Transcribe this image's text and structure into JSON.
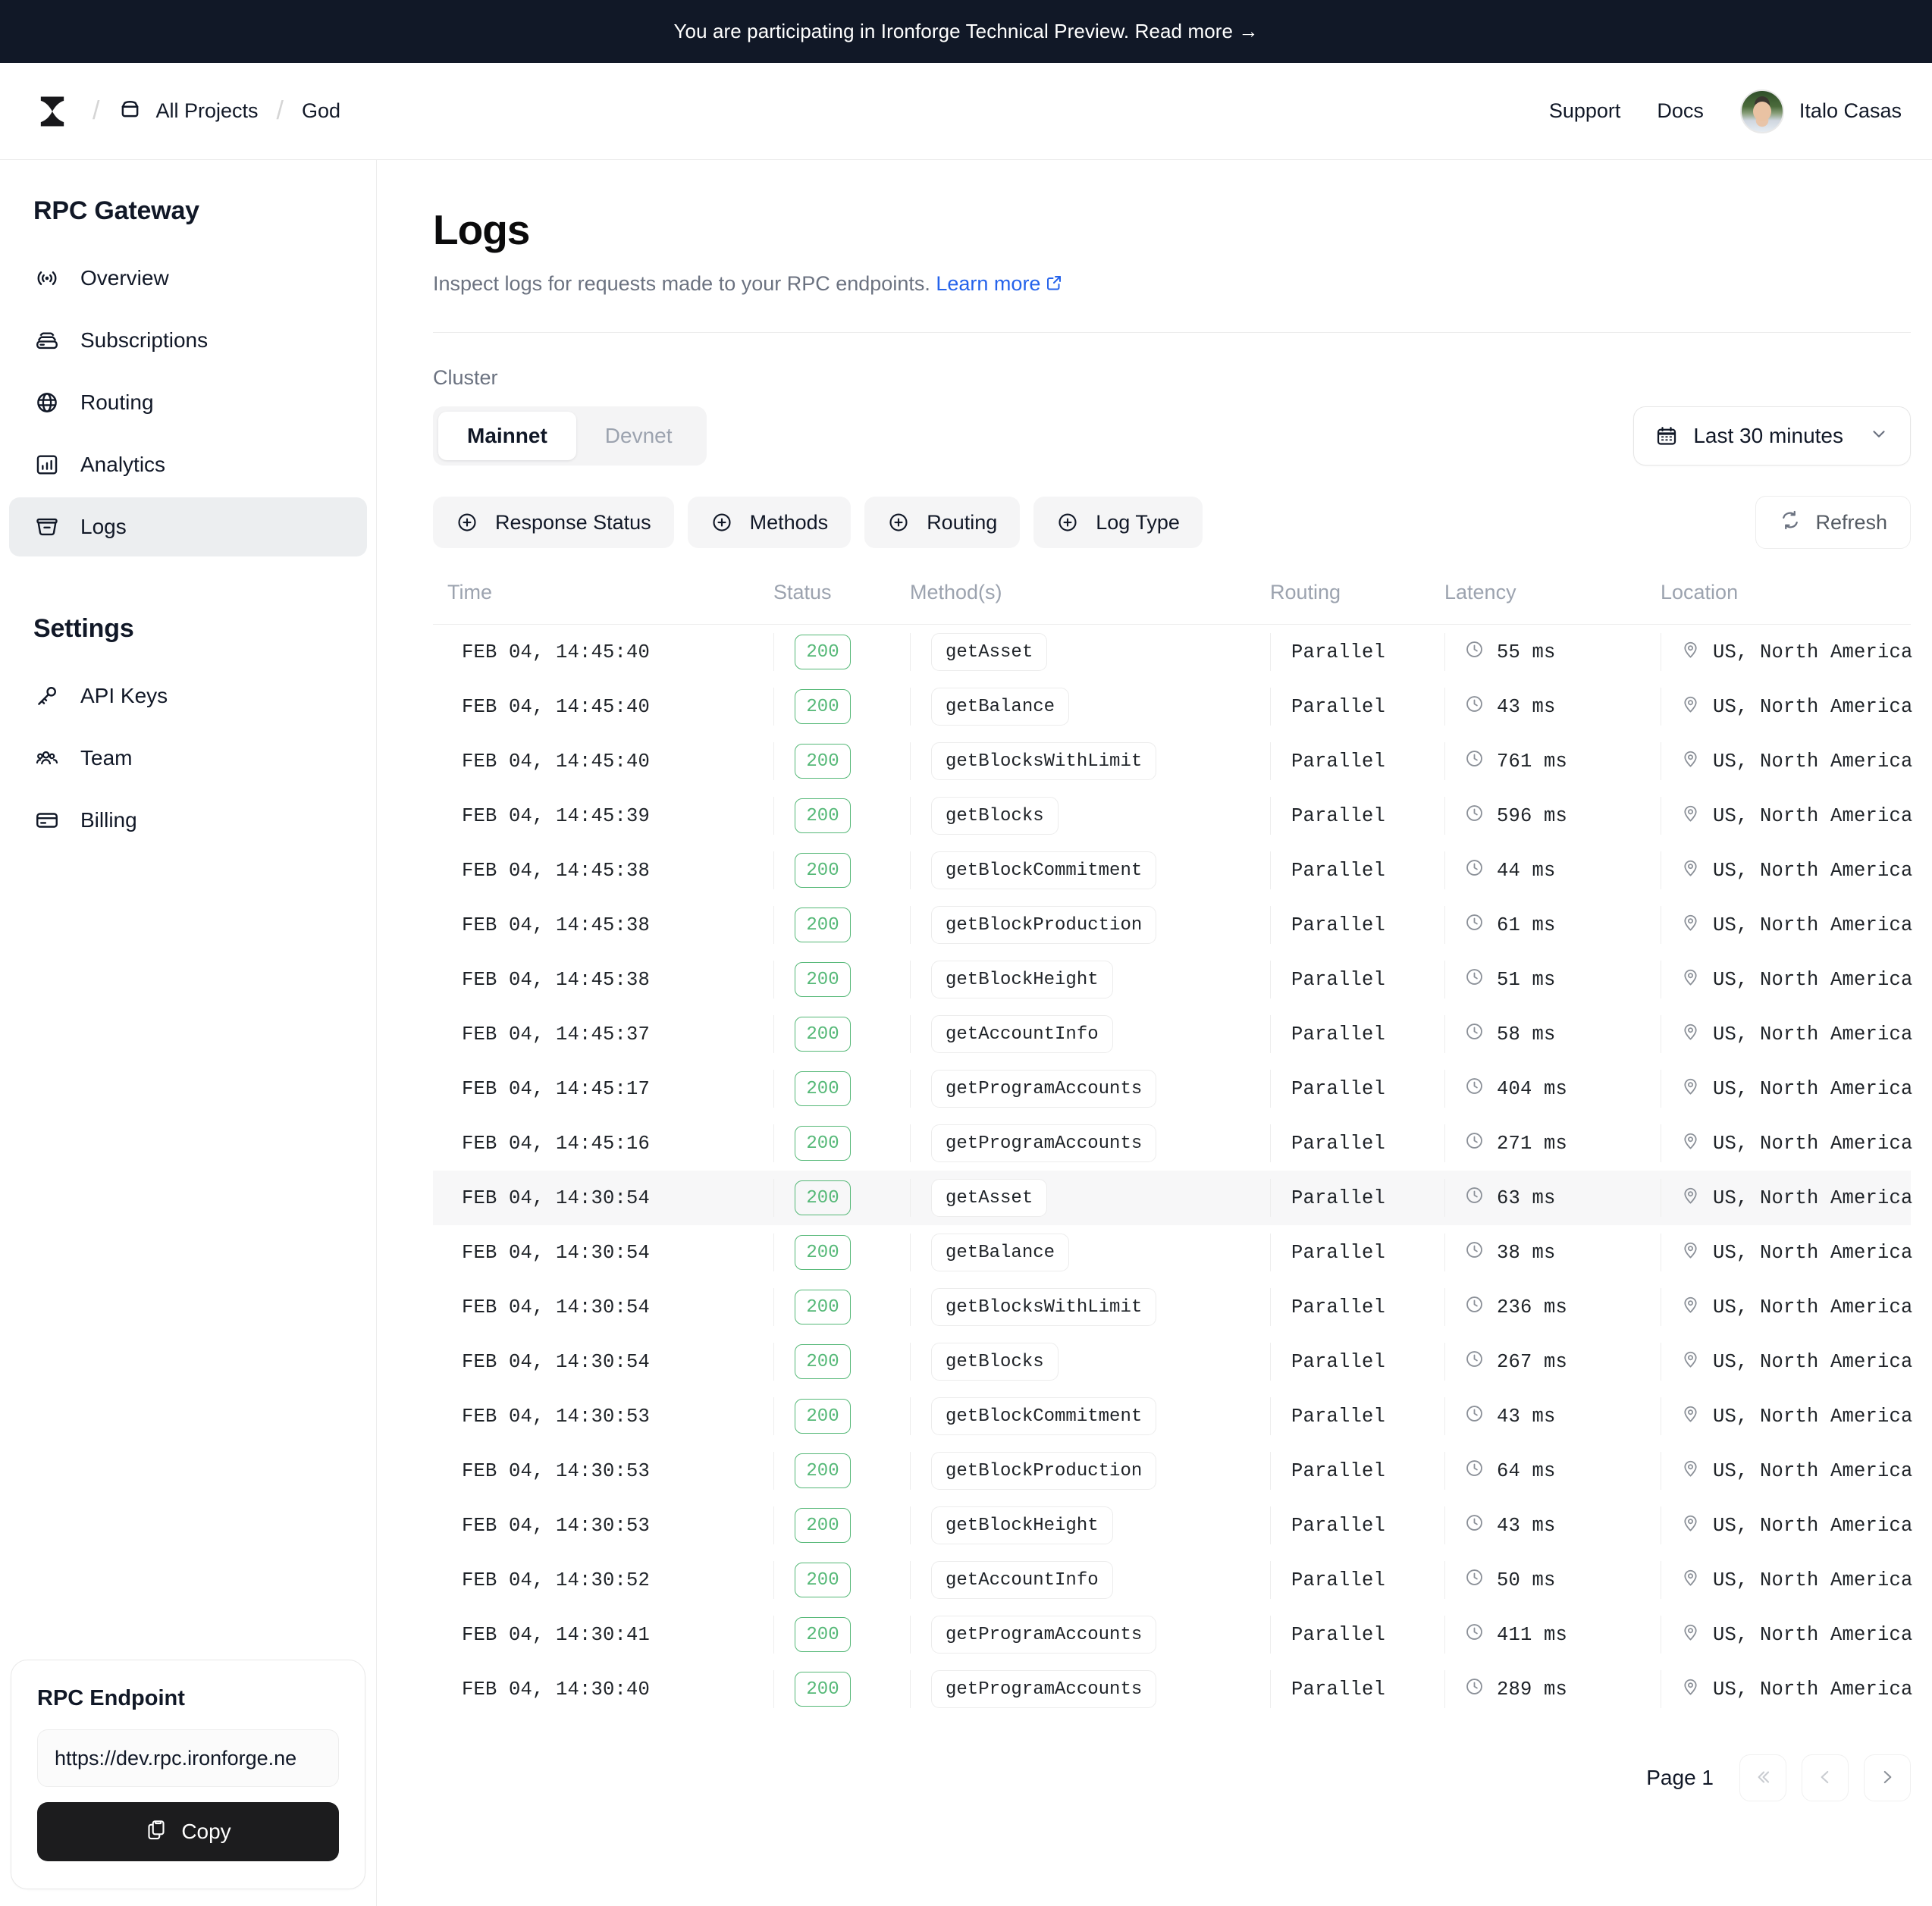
{
  "announcement": {
    "text": "You are participating in Ironforge Technical Preview. Read more →"
  },
  "topnav": {
    "logo_icon": "anvil-logo",
    "breadcrumb": [
      {
        "label": "All Projects",
        "icon": "box-icon"
      },
      {
        "label": "God",
        "icon": ""
      }
    ],
    "links": [
      "Support",
      "Docs"
    ],
    "user": {
      "name": "Italo Casas",
      "avatar_icon": "user-avatar"
    }
  },
  "sidebar": {
    "section1_title": "RPC Gateway",
    "section1_items": [
      {
        "label": "Overview",
        "icon": "broadcast-icon",
        "active": false
      },
      {
        "label": "Subscriptions",
        "icon": "server-stack-icon",
        "active": false
      },
      {
        "label": "Routing",
        "icon": "globe-icon",
        "active": false
      },
      {
        "label": "Analytics",
        "icon": "bar-chart-icon",
        "active": false
      },
      {
        "label": "Logs",
        "icon": "logs-box-icon",
        "active": true
      }
    ],
    "section2_title": "Settings",
    "section2_items": [
      {
        "label": "API Keys",
        "icon": "key-icon",
        "active": false
      },
      {
        "label": "Team",
        "icon": "users-icon",
        "active": false
      },
      {
        "label": "Billing",
        "icon": "credit-card-icon",
        "active": false
      }
    ],
    "endpoint_card": {
      "title": "RPC Endpoint",
      "value": "https://dev.rpc.ironforge.ne",
      "placeholder": "https://dev.rpc.ironforge.ne",
      "copy_label": "Copy",
      "copy_icon": "clipboard-icon"
    }
  },
  "main": {
    "title": "Logs",
    "subtitle": "Inspect logs for requests made to your RPC endpoints.",
    "subtitle_link": "Learn more",
    "cluster_label": "Cluster",
    "cluster_tabs": [
      {
        "label": "Mainnet",
        "active": true
      },
      {
        "label": "Devnet",
        "active": false
      }
    ],
    "date_range": {
      "label": "Last 30 minutes",
      "icon": "calendar-icon",
      "chevron": "chevron-down-icon"
    },
    "filters": [
      {
        "label": "Response Status",
        "icon": "plus-circle-icon"
      },
      {
        "label": "Methods",
        "icon": "plus-circle-icon"
      },
      {
        "label": "Routing",
        "icon": "plus-circle-icon"
      },
      {
        "label": "Log Type",
        "icon": "plus-circle-icon"
      }
    ],
    "refresh": {
      "label": "Refresh",
      "icon": "refresh-icon"
    },
    "table": {
      "columns": [
        "Time",
        "Status",
        "Method(s)",
        "Routing",
        "Latency",
        "Location"
      ],
      "status_color": "#55b877",
      "rows": [
        {
          "time": "FEB 04, 14:45:40",
          "status": "200",
          "method": "getAsset",
          "routing": "Parallel",
          "latency": "55 ms",
          "location": "US, North America",
          "highlighted": false
        },
        {
          "time": "FEB 04, 14:45:40",
          "status": "200",
          "method": "getBalance",
          "routing": "Parallel",
          "latency": "43 ms",
          "location": "US, North America",
          "highlighted": false
        },
        {
          "time": "FEB 04, 14:45:40",
          "status": "200",
          "method": "getBlocksWithLimit",
          "routing": "Parallel",
          "latency": "761 ms",
          "location": "US, North America",
          "highlighted": false
        },
        {
          "time": "FEB 04, 14:45:39",
          "status": "200",
          "method": "getBlocks",
          "routing": "Parallel",
          "latency": "596 ms",
          "location": "US, North America",
          "highlighted": false
        },
        {
          "time": "FEB 04, 14:45:38",
          "status": "200",
          "method": "getBlockCommitment",
          "routing": "Parallel",
          "latency": "44 ms",
          "location": "US, North America",
          "highlighted": false
        },
        {
          "time": "FEB 04, 14:45:38",
          "status": "200",
          "method": "getBlockProduction",
          "routing": "Parallel",
          "latency": "61 ms",
          "location": "US, North America",
          "highlighted": false
        },
        {
          "time": "FEB 04, 14:45:38",
          "status": "200",
          "method": "getBlockHeight",
          "routing": "Parallel",
          "latency": "51 ms",
          "location": "US, North America",
          "highlighted": false
        },
        {
          "time": "FEB 04, 14:45:37",
          "status": "200",
          "method": "getAccountInfo",
          "routing": "Parallel",
          "latency": "58 ms",
          "location": "US, North America",
          "highlighted": false
        },
        {
          "time": "FEB 04, 14:45:17",
          "status": "200",
          "method": "getProgramAccounts",
          "routing": "Parallel",
          "latency": "404 ms",
          "location": "US, North America",
          "highlighted": false
        },
        {
          "time": "FEB 04, 14:45:16",
          "status": "200",
          "method": "getProgramAccounts",
          "routing": "Parallel",
          "latency": "271 ms",
          "location": "US, North America",
          "highlighted": false
        },
        {
          "time": "FEB 04, 14:30:54",
          "status": "200",
          "method": "getAsset",
          "routing": "Parallel",
          "latency": "63 ms",
          "location": "US, North America",
          "highlighted": true
        },
        {
          "time": "FEB 04, 14:30:54",
          "status": "200",
          "method": "getBalance",
          "routing": "Parallel",
          "latency": "38 ms",
          "location": "US, North America",
          "highlighted": false
        },
        {
          "time": "FEB 04, 14:30:54",
          "status": "200",
          "method": "getBlocksWithLimit",
          "routing": "Parallel",
          "latency": "236 ms",
          "location": "US, North America",
          "highlighted": false
        },
        {
          "time": "FEB 04, 14:30:54",
          "status": "200",
          "method": "getBlocks",
          "routing": "Parallel",
          "latency": "267 ms",
          "location": "US, North America",
          "highlighted": false
        },
        {
          "time": "FEB 04, 14:30:53",
          "status": "200",
          "method": "getBlockCommitment",
          "routing": "Parallel",
          "latency": "43 ms",
          "location": "US, North America",
          "highlighted": false
        },
        {
          "time": "FEB 04, 14:30:53",
          "status": "200",
          "method": "getBlockProduction",
          "routing": "Parallel",
          "latency": "64 ms",
          "location": "US, North America",
          "highlighted": false
        },
        {
          "time": "FEB 04, 14:30:53",
          "status": "200",
          "method": "getBlockHeight",
          "routing": "Parallel",
          "latency": "43 ms",
          "location": "US, North America",
          "highlighted": false
        },
        {
          "time": "FEB 04, 14:30:52",
          "status": "200",
          "method": "getAccountInfo",
          "routing": "Parallel",
          "latency": "50 ms",
          "location": "US, North America",
          "highlighted": false
        },
        {
          "time": "FEB 04, 14:30:41",
          "status": "200",
          "method": "getProgramAccounts",
          "routing": "Parallel",
          "latency": "411 ms",
          "location": "US, North America",
          "highlighted": false
        },
        {
          "time": "FEB 04, 14:30:40",
          "status": "200",
          "method": "getProgramAccounts",
          "routing": "Parallel",
          "latency": "289 ms",
          "location": "US, North America",
          "highlighted": false
        }
      ]
    },
    "pagination": {
      "page_label": "Page 1",
      "first_icon": "chevron-double-left-icon",
      "prev_icon": "chevron-left-icon",
      "next_icon": "chevron-right-icon"
    }
  }
}
